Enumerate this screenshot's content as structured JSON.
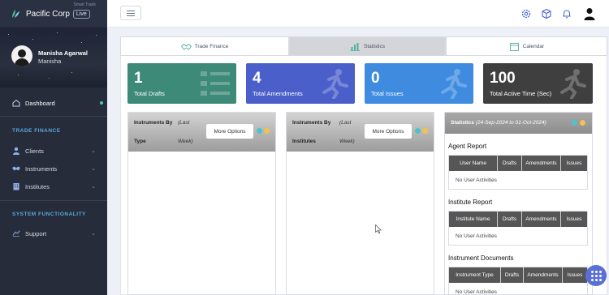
{
  "brand": {
    "name": "Pacific Corp",
    "badge": "Live",
    "tag": "Smart Trade"
  },
  "user": {
    "name": "Manisha Agarwal",
    "handle": "Manisha"
  },
  "sidebar": {
    "dashboard": "Dashboard",
    "section_trade": "TRADE FINANCE",
    "clients": "Clients",
    "instruments": "Instruments",
    "institutes": "Institutes",
    "section_system": "SYSTEM FUNCTIONALITY",
    "support": "Support"
  },
  "tabs": [
    {
      "label": "Trade Finance",
      "icon": "handshake-icon"
    },
    {
      "label": "Statistics",
      "icon": "bar-chart-icon"
    },
    {
      "label": "Calendar",
      "icon": "calendar-icon"
    }
  ],
  "cards": [
    {
      "value": "1",
      "label": "Total Drafts",
      "color": "#3d8a78"
    },
    {
      "value": "4",
      "label": "Total Amendments",
      "color": "#4a5fc9"
    },
    {
      "value": "0",
      "label": "Total Issues",
      "color": "#3e8be0"
    },
    {
      "value": "100",
      "label": "Total Active Time (Sec)",
      "color": "#3f3f3f"
    }
  ],
  "panels": {
    "instruments_type": {
      "title_1": "Instruments By",
      "title_2": "Type",
      "sub_1": "(Last",
      "sub_2": "Week)",
      "button": "More Options"
    },
    "instruments_institutes": {
      "title_1": "Instruments By",
      "title_2": "Institutes",
      "sub_1": "(Last",
      "sub_2": "Week)",
      "button": "More Options"
    }
  },
  "stats": {
    "title": "Statistics",
    "range": "(24-Sep-2024 to 01-Oct-2024)",
    "agent_report": "Agent Report",
    "agent_cols": [
      "User Name",
      "Drafts",
      "Amendments",
      "Issues"
    ],
    "agent_empty": "No User Activities",
    "institute_report": "Institute Report",
    "institute_cols": [
      "Institute Name",
      "Drafts",
      "Amendments",
      "Issues"
    ],
    "institute_empty": "No User Activities",
    "instrument_docs": "Instrument Documents",
    "doc_cols": [
      "Instrument Type",
      "Drafts",
      "Amendments",
      "Issues"
    ],
    "doc_empty": "No User Activities"
  },
  "colors": {
    "dot_teal": "#4fc3c8",
    "dot_yellow": "#f2c14e",
    "accent": "#5a6fd6"
  }
}
